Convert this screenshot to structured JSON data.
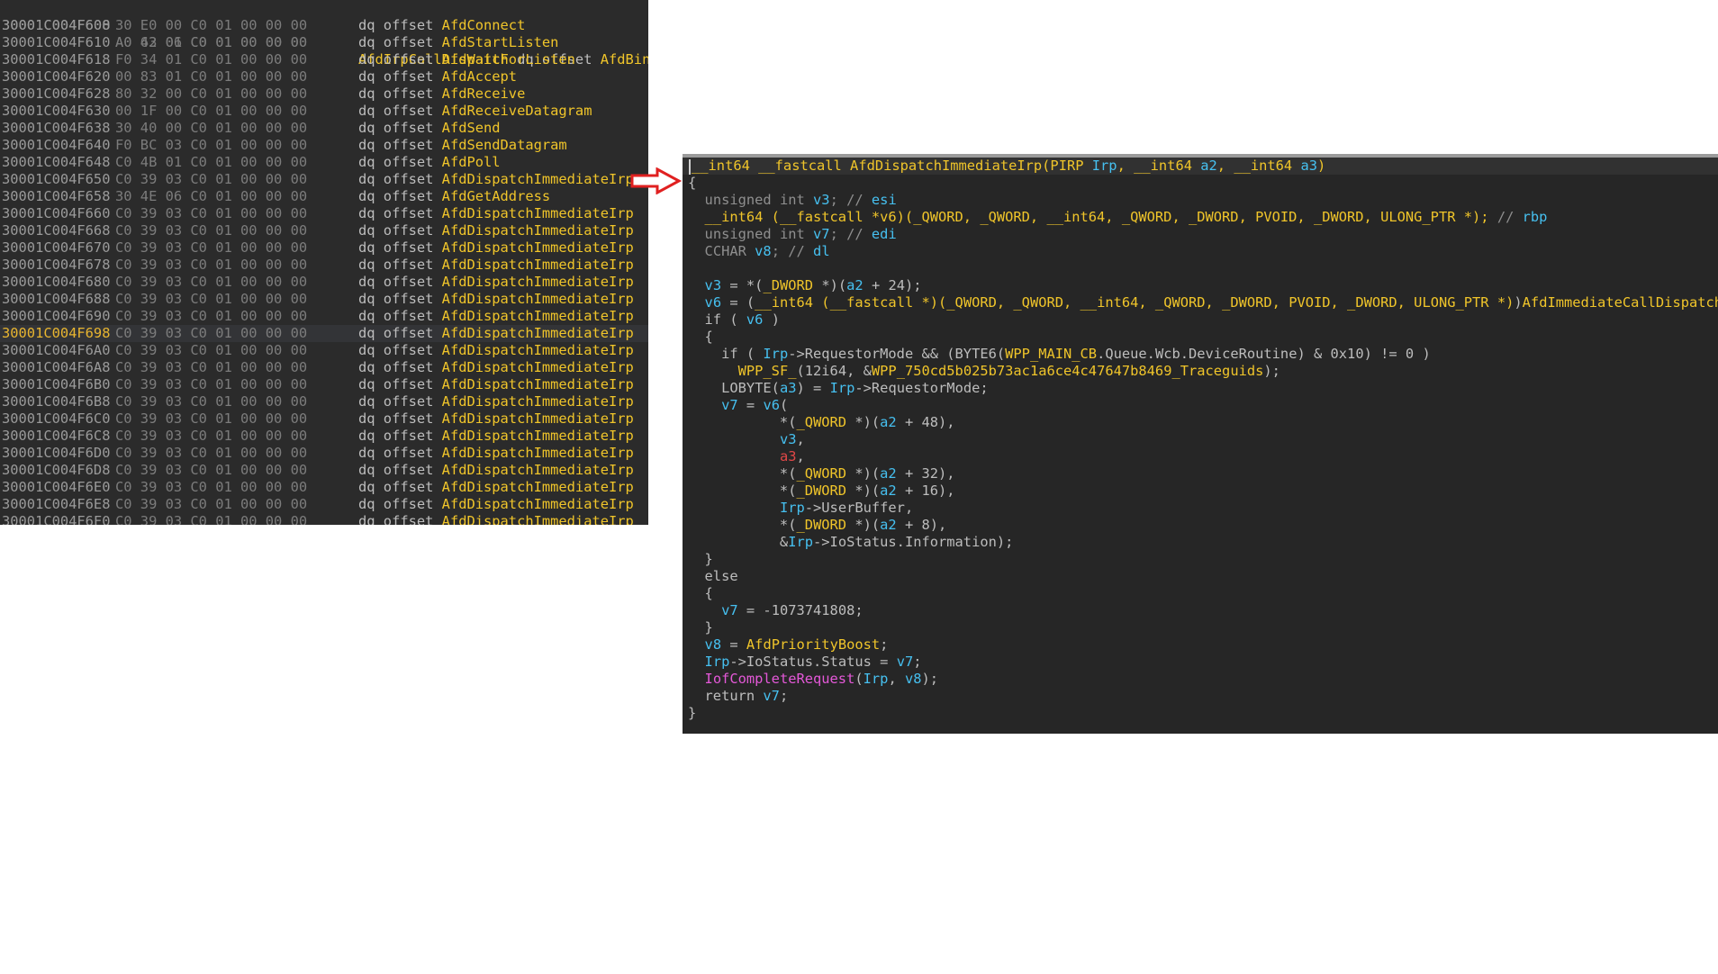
{
  "listing": {
    "header": {
      "addr": "30001C004F600",
      "bytes": "A0 42 06 C0 01 00 00 00",
      "name": "AfdIrpCallDispatch",
      "instr": " dq offset ",
      "sym": "AfdBind"
    },
    "rows": [
      {
        "addr": "30001C004F608",
        "bytes": "30 E0 00 C0 01 00 00 00",
        "instr": "dq offset ",
        "sym": "AfdConnect"
      },
      {
        "addr": "30001C004F610",
        "bytes": "A0 63 01 C0 01 00 00 00",
        "instr": "dq offset ",
        "sym": "AfdStartListen"
      },
      {
        "addr": "30001C004F618",
        "bytes": "F0 34 01 C0 01 00 00 00",
        "instr": "dq offset ",
        "sym": "AfdWaitForListen"
      },
      {
        "addr": "30001C004F620",
        "bytes": "00 83 01 C0 01 00 00 00",
        "instr": "dq offset ",
        "sym": "AfdAccept"
      },
      {
        "addr": "30001C004F628",
        "bytes": "80 32 00 C0 01 00 00 00",
        "instr": "dq offset ",
        "sym": "AfdReceive"
      },
      {
        "addr": "30001C004F630",
        "bytes": "00 1F 00 C0 01 00 00 00",
        "instr": "dq offset ",
        "sym": "AfdReceiveDatagram"
      },
      {
        "addr": "30001C004F638",
        "bytes": "30 40 00 C0 01 00 00 00",
        "instr": "dq offset ",
        "sym": "AfdSend"
      },
      {
        "addr": "30001C004F640",
        "bytes": "F0 BC 03 C0 01 00 00 00",
        "instr": "dq offset ",
        "sym": "AfdSendDatagram"
      },
      {
        "addr": "30001C004F648",
        "bytes": "C0 4B 01 C0 01 00 00 00",
        "instr": "dq offset ",
        "sym": "AfdPoll"
      },
      {
        "addr": "30001C004F650",
        "bytes": "C0 39 03 C0 01 00 00 00",
        "instr": "dq offset ",
        "sym": "AfdDispatchImmediateIrp"
      },
      {
        "addr": "30001C004F658",
        "bytes": "30 4E 06 C0 01 00 00 00",
        "instr": "dq offset ",
        "sym": "AfdGetAddress"
      },
      {
        "addr": "30001C004F660",
        "bytes": "C0 39 03 C0 01 00 00 00",
        "instr": "dq offset ",
        "sym": "AfdDispatchImmediateIrp"
      },
      {
        "addr": "30001C004F668",
        "bytes": "C0 39 03 C0 01 00 00 00",
        "instr": "dq offset ",
        "sym": "AfdDispatchImmediateIrp"
      },
      {
        "addr": "30001C004F670",
        "bytes": "C0 39 03 C0 01 00 00 00",
        "instr": "dq offset ",
        "sym": "AfdDispatchImmediateIrp"
      },
      {
        "addr": "30001C004F678",
        "bytes": "C0 39 03 C0 01 00 00 00",
        "instr": "dq offset ",
        "sym": "AfdDispatchImmediateIrp"
      },
      {
        "addr": "30001C004F680",
        "bytes": "C0 39 03 C0 01 00 00 00",
        "instr": "dq offset ",
        "sym": "AfdDispatchImmediateIrp"
      },
      {
        "addr": "30001C004F688",
        "bytes": "C0 39 03 C0 01 00 00 00",
        "instr": "dq offset ",
        "sym": "AfdDispatchImmediateIrp"
      },
      {
        "addr": "30001C004F690",
        "bytes": "C0 39 03 C0 01 00 00 00",
        "instr": "dq offset ",
        "sym": "AfdDispatchImmediateIrp"
      },
      {
        "addr": "30001C004F698",
        "bytes": "C0 39 03 C0 01 00 00 00",
        "instr": "dq offset ",
        "sym": "AfdDispatchImmediateIrp",
        "selected": true
      },
      {
        "addr": "30001C004F6A0",
        "bytes": "C0 39 03 C0 01 00 00 00",
        "instr": "dq offset ",
        "sym": "AfdDispatchImmediateIrp"
      },
      {
        "addr": "30001C004F6A8",
        "bytes": "C0 39 03 C0 01 00 00 00",
        "instr": "dq offset ",
        "sym": "AfdDispatchImmediateIrp"
      },
      {
        "addr": "30001C004F6B0",
        "bytes": "C0 39 03 C0 01 00 00 00",
        "instr": "dq offset ",
        "sym": "AfdDispatchImmediateIrp"
      },
      {
        "addr": "30001C004F6B8",
        "bytes": "C0 39 03 C0 01 00 00 00",
        "instr": "dq offset ",
        "sym": "AfdDispatchImmediateIrp"
      },
      {
        "addr": "30001C004F6C0",
        "bytes": "C0 39 03 C0 01 00 00 00",
        "instr": "dq offset ",
        "sym": "AfdDispatchImmediateIrp"
      },
      {
        "addr": "30001C004F6C8",
        "bytes": "C0 39 03 C0 01 00 00 00",
        "instr": "dq offset ",
        "sym": "AfdDispatchImmediateIrp"
      },
      {
        "addr": "30001C004F6D0",
        "bytes": "C0 39 03 C0 01 00 00 00",
        "instr": "dq offset ",
        "sym": "AfdDispatchImmediateIrp"
      },
      {
        "addr": "30001C004F6D8",
        "bytes": "C0 39 03 C0 01 00 00 00",
        "instr": "dq offset ",
        "sym": "AfdDispatchImmediateIrp"
      },
      {
        "addr": "30001C004F6E0",
        "bytes": "C0 39 03 C0 01 00 00 00",
        "instr": "dq offset ",
        "sym": "AfdDispatchImmediateIrp"
      },
      {
        "addr": "30001C004F6E8",
        "bytes": "C0 39 03 C0 01 00 00 00",
        "instr": "dq offset ",
        "sym": "AfdDispatchImmediateIrp"
      },
      {
        "addr": "30001C004F6F0",
        "bytes": "C0 39 03 C0 01 00 00 00",
        "instr": "dq offset ",
        "sym": "AfdDispatchImmediateIrp"
      }
    ]
  },
  "arrow": {
    "icon": "right-arrow-icon",
    "color": "#e02020"
  },
  "pseudocode": {
    "lines": [
      [
        [
          "kw",
          "__int64 __fastcall AfdDispatchImmediateIrp(PIRP "
        ],
        [
          "var",
          "Irp"
        ],
        [
          "kw",
          ", __int64 "
        ],
        [
          "var",
          "a2"
        ],
        [
          "kw",
          ", __int64 "
        ],
        [
          "var",
          "a3"
        ],
        [
          "kw",
          ")"
        ]
      ],
      [
        [
          "plain",
          "{"
        ]
      ],
      [
        [
          "plain",
          "  "
        ],
        [
          "cmt",
          "unsigned int "
        ],
        [
          "var",
          "v3"
        ],
        [
          "cmt",
          "; // "
        ],
        [
          "var",
          "esi"
        ]
      ],
      [
        [
          "plain",
          "  "
        ],
        [
          "kw",
          "__int64 (__fastcall *v6)(_QWORD, _QWORD, __int64, _QWORD, _DWORD, PVOID, _DWORD, ULONG_PTR *); "
        ],
        [
          "cmt",
          "// "
        ],
        [
          "var",
          "rbp"
        ]
      ],
      [
        [
          "plain",
          "  "
        ],
        [
          "cmt",
          "unsigned int "
        ],
        [
          "var",
          "v7"
        ],
        [
          "cmt",
          "; // "
        ],
        [
          "var",
          "edi"
        ]
      ],
      [
        [
          "plain",
          "  "
        ],
        [
          "cmt",
          "CCHAR "
        ],
        [
          "var",
          "v8"
        ],
        [
          "cmt",
          "; // "
        ],
        [
          "var",
          "dl"
        ]
      ],
      [
        [
          "plain",
          ""
        ]
      ],
      [
        [
          "plain",
          "  "
        ],
        [
          "var",
          "v3"
        ],
        [
          "plain",
          " = *("
        ],
        [
          "kw",
          "_DWORD"
        ],
        [
          "plain",
          " *)("
        ],
        [
          "var",
          "a2"
        ],
        [
          "plain",
          " + 24);"
        ]
      ],
      [
        [
          "plain",
          "  "
        ],
        [
          "var",
          "v6"
        ],
        [
          "plain",
          " = ("
        ],
        [
          "kw",
          "__int64 (__fastcall *)(_QWORD, _QWORD, __int64, _QWORD, _DWORD, PVOID, _DWORD, ULONG_PTR *)"
        ],
        [
          "plain",
          ")"
        ],
        [
          "kw",
          "AfdImmediateCallDispatch"
        ],
        [
          "plain",
          "[("
        ],
        [
          "var",
          "v"
        ]
      ],
      [
        [
          "plain",
          "  if ( "
        ],
        [
          "var",
          "v6"
        ],
        [
          "plain",
          " )"
        ]
      ],
      [
        [
          "plain",
          "  {"
        ]
      ],
      [
        [
          "plain",
          "    if ( "
        ],
        [
          "var",
          "Irp"
        ],
        [
          "plain",
          "->RequestorMode && (BYTE6("
        ],
        [
          "kw",
          "WPP_MAIN_CB"
        ],
        [
          "plain",
          ".Queue.Wcb.DeviceRoutine) & 0x10) != 0 )"
        ]
      ],
      [
        [
          "plain",
          "      "
        ],
        [
          "kw",
          "WPP_SF_"
        ],
        [
          "plain",
          "(12i64, &"
        ],
        [
          "kw",
          "WPP_750cd5b025b73ac1a6ce4c47647b8469_Traceguids"
        ],
        [
          "plain",
          ");"
        ]
      ],
      [
        [
          "plain",
          "    LOBYTE("
        ],
        [
          "var",
          "a3"
        ],
        [
          "plain",
          ") = "
        ],
        [
          "var",
          "Irp"
        ],
        [
          "plain",
          "->RequestorMode;"
        ]
      ],
      [
        [
          "plain",
          "    "
        ],
        [
          "var",
          "v7"
        ],
        [
          "plain",
          " = "
        ],
        [
          "var",
          "v6"
        ],
        [
          "plain",
          "("
        ]
      ],
      [
        [
          "plain",
          "           *("
        ],
        [
          "kw",
          "_QWORD"
        ],
        [
          "plain",
          " *)("
        ],
        [
          "var",
          "a2"
        ],
        [
          "plain",
          " + 48),"
        ]
      ],
      [
        [
          "plain",
          "           "
        ],
        [
          "var",
          "v3"
        ],
        [
          "plain",
          ","
        ]
      ],
      [
        [
          "plain",
          "           "
        ],
        [
          "arg",
          "a3"
        ],
        [
          "plain",
          ","
        ]
      ],
      [
        [
          "plain",
          "           *("
        ],
        [
          "kw",
          "_QWORD"
        ],
        [
          "plain",
          " *)("
        ],
        [
          "var",
          "a2"
        ],
        [
          "plain",
          " + 32),"
        ]
      ],
      [
        [
          "plain",
          "           *("
        ],
        [
          "kw",
          "_DWORD"
        ],
        [
          "plain",
          " *)("
        ],
        [
          "var",
          "a2"
        ],
        [
          "plain",
          " + 16),"
        ]
      ],
      [
        [
          "plain",
          "           "
        ],
        [
          "var",
          "Irp"
        ],
        [
          "plain",
          "->UserBuffer,"
        ]
      ],
      [
        [
          "plain",
          "           *("
        ],
        [
          "kw",
          "_DWORD"
        ],
        [
          "plain",
          " *)("
        ],
        [
          "var",
          "a2"
        ],
        [
          "plain",
          " + 8),"
        ]
      ],
      [
        [
          "plain",
          "           &"
        ],
        [
          "var",
          "Irp"
        ],
        [
          "plain",
          "->IoStatus.Information);"
        ]
      ],
      [
        [
          "plain",
          "  }"
        ]
      ],
      [
        [
          "plain",
          "  else"
        ]
      ],
      [
        [
          "plain",
          "  {"
        ]
      ],
      [
        [
          "plain",
          "    "
        ],
        [
          "var",
          "v7"
        ],
        [
          "plain",
          " = -1073741808;"
        ]
      ],
      [
        [
          "plain",
          "  }"
        ]
      ],
      [
        [
          "plain",
          "  "
        ],
        [
          "var",
          "v8"
        ],
        [
          "plain",
          " = "
        ],
        [
          "kw",
          "AfdPriorityBoost"
        ],
        [
          "plain",
          ";"
        ]
      ],
      [
        [
          "plain",
          "  "
        ],
        [
          "var",
          "Irp"
        ],
        [
          "plain",
          "->IoStatus.Status = "
        ],
        [
          "var",
          "v7"
        ],
        [
          "plain",
          ";"
        ]
      ],
      [
        [
          "plain",
          "  "
        ],
        [
          "imp",
          "IofCompleteRequest"
        ],
        [
          "plain",
          "("
        ],
        [
          "var",
          "Irp"
        ],
        [
          "plain",
          ", "
        ],
        [
          "var",
          "v8"
        ],
        [
          "plain",
          ");"
        ]
      ],
      [
        [
          "plain",
          "  return "
        ],
        [
          "var",
          "v7"
        ],
        [
          "plain",
          ";"
        ]
      ],
      [
        [
          "plain",
          "}"
        ]
      ]
    ]
  }
}
